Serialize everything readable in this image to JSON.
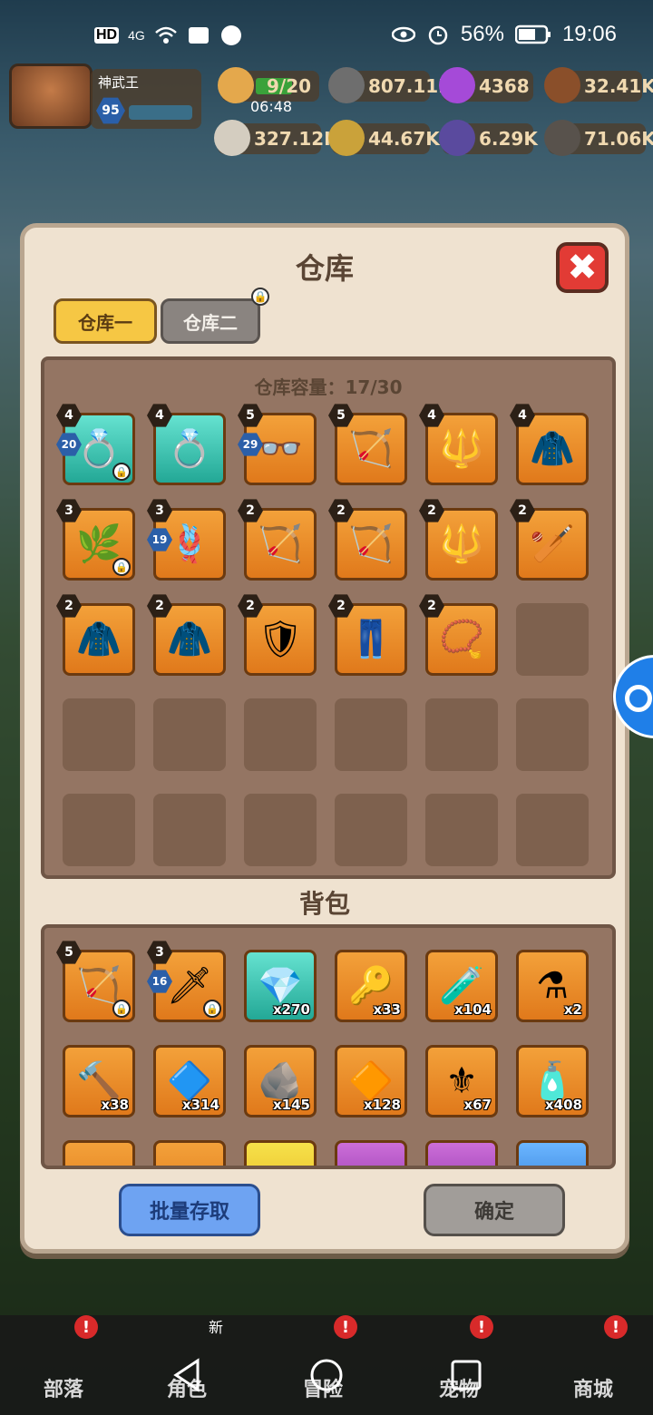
{
  "status_bar": {
    "network_badge": "HD",
    "signal_label": "4G",
    "battery": "56%",
    "time": "19:06"
  },
  "player": {
    "name": "神武王",
    "level": "95"
  },
  "resources": {
    "energy": "9/20",
    "energy_timer": "06:48",
    "stone": "807.11K",
    "gem": "4368",
    "wood": "32.41K",
    "bone": "327.12K",
    "gold": "44.67K",
    "crystal": "6.29K",
    "iron": "71.06K"
  },
  "modal": {
    "title": "仓库",
    "close_label": "✖",
    "tabs": [
      {
        "label": "仓库一",
        "active": true
      },
      {
        "label": "仓库二",
        "active": false,
        "locked": true
      }
    ],
    "capacity_text": "仓库容量：17/30",
    "bag_title": "背包",
    "buttons": {
      "batch": "批量存取",
      "confirm": "确定"
    }
  },
  "warehouse_items": [
    {
      "icon": "blue-dragon-ring",
      "glyph": "💍",
      "rarity": "cyan",
      "stars": "4",
      "plus": "20",
      "locked": true
    },
    {
      "icon": "blue-dragon-ring",
      "glyph": "💍",
      "rarity": "cyan",
      "stars": "4"
    },
    {
      "icon": "goggles",
      "glyph": "👓",
      "rarity": "orange",
      "stars": "5",
      "plus": "29"
    },
    {
      "icon": "ice-bow",
      "glyph": "🏹",
      "rarity": "orange",
      "stars": "5"
    },
    {
      "icon": "golden-spear",
      "glyph": "🔱",
      "rarity": "orange",
      "stars": "4"
    },
    {
      "icon": "hooded-cloak",
      "glyph": "🧥",
      "rarity": "orange",
      "stars": "4"
    },
    {
      "icon": "plant-helmet",
      "glyph": "🌿",
      "rarity": "orange",
      "stars": "3",
      "locked": true
    },
    {
      "icon": "whip",
      "glyph": "🪢",
      "rarity": "orange",
      "stars": "3",
      "plus": "19"
    },
    {
      "icon": "ice-bow",
      "glyph": "🏹",
      "rarity": "orange",
      "stars": "2"
    },
    {
      "icon": "ice-bow",
      "glyph": "🏹",
      "rarity": "orange",
      "stars": "2"
    },
    {
      "icon": "golden-spear",
      "glyph": "🔱",
      "rarity": "orange",
      "stars": "2"
    },
    {
      "icon": "golden-club",
      "glyph": "🏏",
      "rarity": "orange",
      "stars": "2"
    },
    {
      "icon": "hooded-cloak",
      "glyph": "🧥",
      "rarity": "orange",
      "stars": "2"
    },
    {
      "icon": "hooded-cloak",
      "glyph": "🧥",
      "rarity": "orange",
      "stars": "2"
    },
    {
      "icon": "armor-chest",
      "glyph": "🛡",
      "rarity": "orange",
      "stars": "2"
    },
    {
      "icon": "leather-pants",
      "glyph": "👖",
      "rarity": "orange",
      "stars": "2"
    },
    {
      "icon": "star-necklace",
      "glyph": "📿",
      "rarity": "orange",
      "stars": "2"
    }
  ],
  "warehouse_capacity": 30,
  "bag_items": [
    {
      "icon": "demon-bow",
      "glyph": "🏹",
      "rarity": "orange",
      "stars": "5",
      "locked": true
    },
    {
      "icon": "skull-spear",
      "glyph": "🗡",
      "rarity": "orange",
      "stars": "3",
      "plus": "16",
      "locked": true
    },
    {
      "icon": "crystal-crest",
      "glyph": "💎",
      "rarity": "cyan",
      "qty": "x270"
    },
    {
      "icon": "magic-key",
      "glyph": "🔑",
      "rarity": "orange",
      "qty": "x33"
    },
    {
      "icon": "potion-jar",
      "glyph": "🧪",
      "rarity": "orange",
      "qty": "x104"
    },
    {
      "icon": "green-potion",
      "glyph": "⚗",
      "rarity": "orange",
      "qty": "x2"
    },
    {
      "icon": "forge-hammer",
      "glyph": "🔨",
      "rarity": "orange",
      "qty": "x38"
    },
    {
      "icon": "blue-crystal",
      "glyph": "🔷",
      "rarity": "orange",
      "qty": "x314"
    },
    {
      "icon": "rune-stone",
      "glyph": "🪨",
      "rarity": "orange",
      "qty": "x145"
    },
    {
      "icon": "red-crystal",
      "glyph": "🔶",
      "rarity": "orange",
      "qty": "x128"
    },
    {
      "icon": "gold-emblem",
      "glyph": "⚜",
      "rarity": "orange",
      "qty": "x67"
    },
    {
      "icon": "paint-tube",
      "glyph": "🧴",
      "rarity": "orange",
      "qty": "x408"
    },
    {
      "icon": "item-partial",
      "glyph": "",
      "rarity": "orange"
    },
    {
      "icon": "item-partial",
      "glyph": "",
      "rarity": "orange"
    },
    {
      "icon": "item-partial",
      "glyph": "",
      "rarity": "yellow"
    },
    {
      "icon": "item-partial",
      "glyph": "",
      "rarity": "purple"
    },
    {
      "icon": "item-partial",
      "glyph": "",
      "rarity": "purple"
    },
    {
      "icon": "item-partial",
      "glyph": "",
      "rarity": "blue"
    }
  ],
  "bottom_nav": [
    {
      "label": "部落",
      "badge": "!"
    },
    {
      "label": "角色",
      "badge": "新"
    },
    {
      "label": "冒险",
      "badge": "!"
    },
    {
      "label": "宠物",
      "badge": "!"
    },
    {
      "label": "商城",
      "badge": "!"
    }
  ],
  "colors": {
    "panel": "#efe2d0",
    "rarity_orange": "#e0791b",
    "rarity_cyan": "#23a896",
    "close_red": "#e23b35"
  }
}
